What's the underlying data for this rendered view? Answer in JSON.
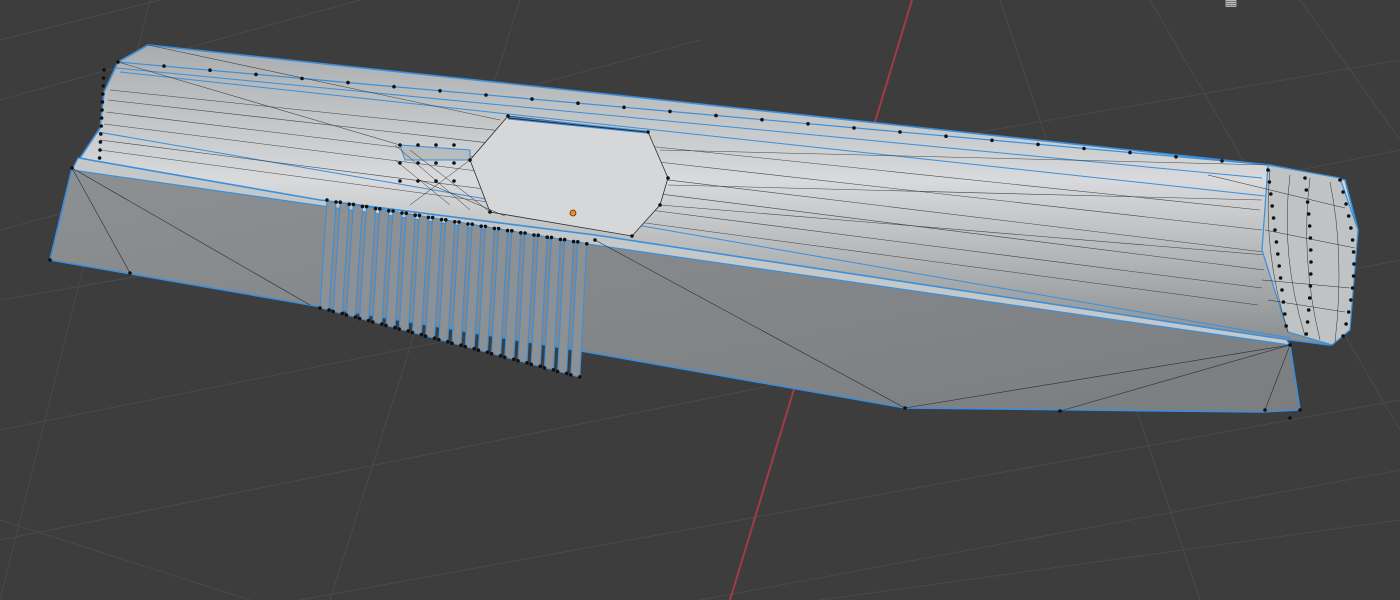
{
  "viewport": {
    "background_color": "#3d3d3d",
    "grid_color": "#4a4a4a",
    "x_axis_color": "#a23b45",
    "selection_outline_color": "#3a8fdc",
    "mesh_face_color": "#8e9193",
    "vertex_color": "#111111",
    "origin_color": "#f08a24",
    "view_gizmo_icon": "grid-view-icon"
  }
}
